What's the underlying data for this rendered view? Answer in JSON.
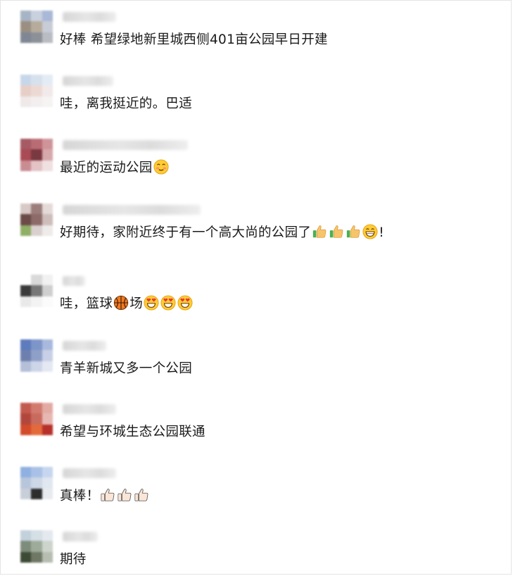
{
  "comments": [
    {
      "text_before": "好棒  希望绿地新里城西侧",
      "number": "401",
      "text_after": "亩公园早日开建",
      "avatar_colors": [
        "#a7b4c5",
        "#c9d1de",
        "#a9b8d6",
        "#9a8f82",
        "#b7ac9c",
        "#c8ccd6",
        "#7f8794",
        "#8c9098",
        "#b9bcc2"
      ]
    },
    {
      "text": "哇，离我挺近的。巴适",
      "avatar_colors": [
        "#c7d7ea",
        "#d7e1ee",
        "#e3ecf5",
        "#e7cfc8",
        "#edd9d3",
        "#f2eaea",
        "#efe9ea",
        "#f3eeef",
        "#f6f3f3"
      ]
    },
    {
      "text": "最近的运动公园",
      "avatar_colors": [
        "#a55a64",
        "#b96c73",
        "#cf9499",
        "#a94a55",
        "#7a3840",
        "#d6a8ab",
        "#c98c92",
        "#e3c3c5",
        "#efe0e1"
      ]
    },
    {
      "text": "好期待，家附近终于有一个高大尚的公园了",
      "avatar_colors": [
        "#d6c9c6",
        "#9b7d7b",
        "#e4dbd9",
        "#6b4a47",
        "#8c6b68",
        "#cdbdbb",
        "#8fae66",
        "#d9d1cf",
        "#eeebea"
      ]
    },
    {
      "text_before": "哇，篮球",
      "text_after": "场",
      "avatar_colors": [
        "#ffffff",
        "#d9d9d9",
        "#f1f1f1",
        "#3a3a3a",
        "#777777",
        "#cfcfcf",
        "#e9e9e9",
        "#f3f3f3",
        "#fbfbfb"
      ]
    },
    {
      "text": "青羊新城又多一个公园",
      "avatar_colors": [
        "#5d7bbd",
        "#7d95c9",
        "#a9b9dd",
        "#6d7fae",
        "#8fa0c8",
        "#c7d0e6",
        "#b4bfd8",
        "#cdd5e8",
        "#e4e8f2"
      ]
    },
    {
      "text": "希望与环城生态公园联通",
      "avatar_colors": [
        "#c25a4e",
        "#d37a6f",
        "#e3aaa3",
        "#b1473c",
        "#c96a5e",
        "#e7b8b2",
        "#d24b2a",
        "#e36a3a",
        "#b8302a"
      ]
    },
    {
      "text": "真棒！",
      "avatar_colors": [
        "#8fb0e0",
        "#a9c1e6",
        "#c6d6ef",
        "#b8c6dc",
        "#cdd7e6",
        "#e1e7ef",
        "#c9cfd8",
        "#2d2d2d",
        "#e7eaee"
      ]
    },
    {
      "text": "期待",
      "avatar_colors": [
        "#c3d1dc",
        "#d4dfe6",
        "#e3e9ee",
        "#7e8c7c",
        "#9fab9a",
        "#cdd4cc",
        "#3d4a36",
        "#6f7864",
        "#b7bdb1"
      ]
    }
  ]
}
